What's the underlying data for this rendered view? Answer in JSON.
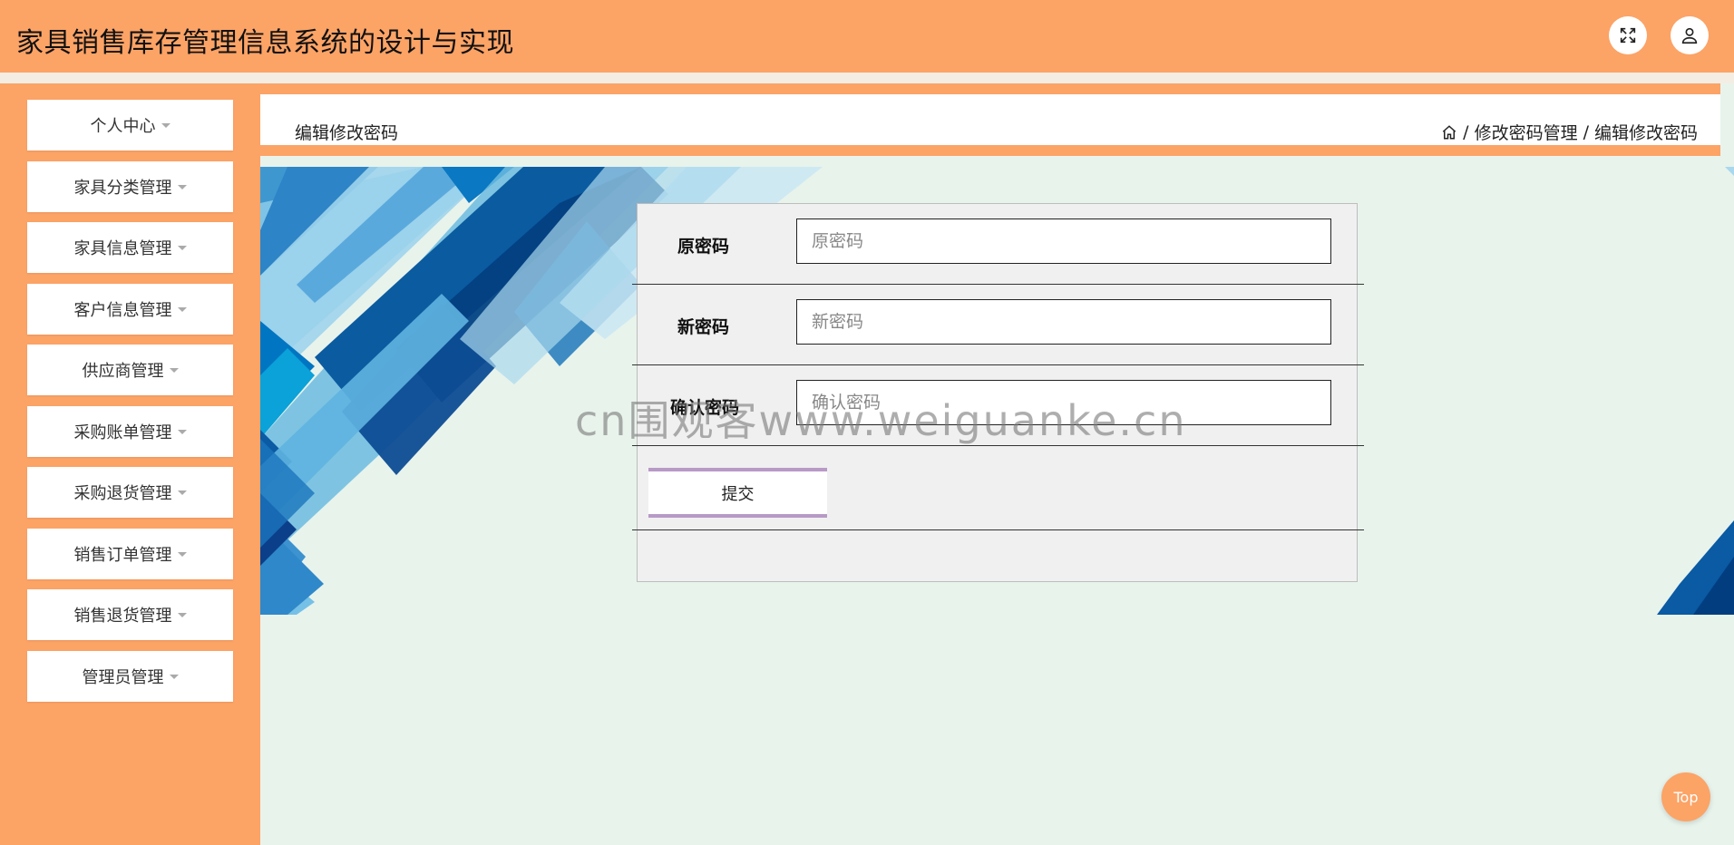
{
  "header": {
    "title": "家具销售库存管理信息系统的设计与实现",
    "fullscreen_icon": "expand-icon",
    "user_icon": "user-icon"
  },
  "sidebar": {
    "items": [
      {
        "label": "个人中心"
      },
      {
        "label": "家具分类管理"
      },
      {
        "label": "家具信息管理"
      },
      {
        "label": "客户信息管理"
      },
      {
        "label": "供应商管理"
      },
      {
        "label": "采购账单管理"
      },
      {
        "label": "采购退货管理"
      },
      {
        "label": "销售订单管理"
      },
      {
        "label": "销售退货管理"
      },
      {
        "label": "管理员管理"
      }
    ]
  },
  "page": {
    "title": "编辑修改密码",
    "breadcrumb": [
      "修改密码管理",
      "编辑修改密码"
    ]
  },
  "form": {
    "fields": [
      {
        "label": "原密码",
        "placeholder": "原密码"
      },
      {
        "label": "新密码",
        "placeholder": "新密码"
      },
      {
        "label": "确认密码",
        "placeholder": "确认密码"
      }
    ],
    "submit_label": "提交"
  },
  "watermark": "cn围观客www.weiguanke.cn",
  "top_button": "Top",
  "colors": {
    "accent": "#fca366",
    "background": "#e8f3ec",
    "button_border": "#b79ac6"
  }
}
